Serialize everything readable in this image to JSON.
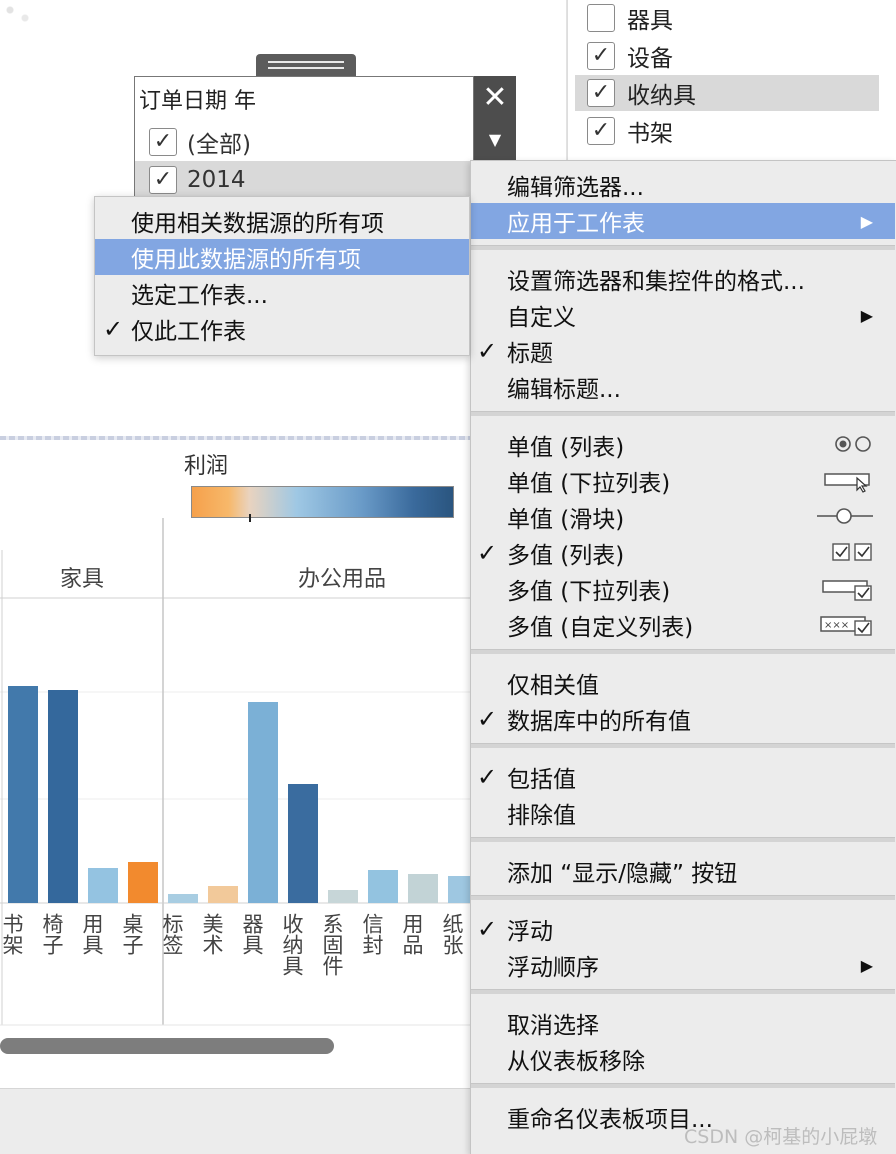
{
  "right_filter": {
    "items": [
      {
        "label": "器具",
        "checked": false,
        "selected": false
      },
      {
        "label": "设备",
        "checked": true,
        "selected": false
      },
      {
        "label": "收纳具",
        "checked": true,
        "selected": true
      },
      {
        "label": "书架",
        "checked": true,
        "selected": false
      }
    ]
  },
  "quick_filter": {
    "title": "订单日期 年",
    "close_icon": "close-icon",
    "dropdown_icon": "dropdown-arrow-icon",
    "items": [
      {
        "label": "(全部)",
        "checked": true,
        "selected": false
      },
      {
        "label": "2014",
        "checked": true,
        "selected": true
      }
    ]
  },
  "legend": {
    "title": "利润",
    "colors": [
      "#f5a04b",
      "#e9d3bf",
      "#9fc8e4",
      "#2a557f"
    ]
  },
  "chart_data": {
    "type": "bar",
    "groups": [
      {
        "name": "家具",
        "categories": [
          "书架",
          "椅子",
          "用具",
          "桌子"
        ]
      },
      {
        "name": "办公用品",
        "categories": [
          "标签",
          "美术",
          "器具",
          "收纳具",
          "系固件",
          "信封",
          "用品",
          "纸张"
        ]
      }
    ],
    "categories": [
      "书架",
      "椅子",
      "用具",
      "桌子",
      "标签",
      "美术",
      "器具",
      "收纳具",
      "系固件",
      "信封",
      "用品",
      "纸张"
    ],
    "values": [
      217,
      213,
      35,
      41,
      9,
      17,
      201,
      119,
      13,
      33,
      29,
      27
    ],
    "colors": [
      "#4279ab",
      "#34689c",
      "#94c3e1",
      "#f28a2e",
      "#a8cde2",
      "#f2c99a",
      "#7bb0d6",
      "#3a6c9f",
      "#c7d6d8",
      "#93c3e0",
      "#c2d3d6",
      "#9ec7e1"
    ],
    "legend_title": "利润",
    "grid": true
  },
  "context_menu": {
    "items": [
      {
        "label": "编辑筛选器...",
        "check": "",
        "arrow": false,
        "icon": ""
      },
      {
        "label": "应用于工作表",
        "check": "",
        "arrow": true,
        "icon": "",
        "highlighted": true
      },
      {
        "sep": true
      },
      {
        "label": "设置筛选器和集控件的格式...",
        "check": "",
        "arrow": false,
        "icon": ""
      },
      {
        "label": "自定义",
        "check": "",
        "arrow": true,
        "icon": ""
      },
      {
        "label": "标题",
        "check": "✓",
        "arrow": false,
        "icon": ""
      },
      {
        "label": "编辑标题...",
        "check": "",
        "arrow": false,
        "icon": ""
      },
      {
        "sep": true
      },
      {
        "label": "单值 (列表)",
        "check": "",
        "arrow": false,
        "icon": "radio-list-icon"
      },
      {
        "label": "单值 (下拉列表)",
        "check": "",
        "arrow": false,
        "icon": "dropdown-cursor-icon"
      },
      {
        "label": "单值 (滑块)",
        "check": "",
        "arrow": false,
        "icon": "slider-icon"
      },
      {
        "label": "多值 (列表)",
        "check": "✓",
        "arrow": false,
        "icon": "checkbox-list-icon"
      },
      {
        "label": "多值 (下拉列表)",
        "check": "",
        "arrow": false,
        "icon": "dropdown-check-icon"
      },
      {
        "label": "多值 (自定义列表)",
        "check": "",
        "arrow": false,
        "icon": "custom-list-icon"
      },
      {
        "sep": true
      },
      {
        "label": "仅相关值",
        "check": "",
        "arrow": false,
        "icon": ""
      },
      {
        "label": "数据库中的所有值",
        "check": "✓",
        "arrow": false,
        "icon": ""
      },
      {
        "sep": true
      },
      {
        "label": "包括值",
        "check": "✓",
        "arrow": false,
        "icon": ""
      },
      {
        "label": "排除值",
        "check": "",
        "arrow": false,
        "icon": ""
      },
      {
        "sep": true
      },
      {
        "label": "添加 “显示/隐藏” 按钮",
        "check": "",
        "arrow": false,
        "icon": ""
      },
      {
        "sep": true
      },
      {
        "label": "浮动",
        "check": "✓",
        "arrow": false,
        "icon": ""
      },
      {
        "label": "浮动顺序",
        "check": "",
        "arrow": true,
        "icon": ""
      },
      {
        "sep": true
      },
      {
        "label": "取消选择",
        "check": "",
        "arrow": false,
        "icon": ""
      },
      {
        "label": "从仪表板移除",
        "check": "",
        "arrow": false,
        "icon": ""
      },
      {
        "sep": true
      },
      {
        "label": "重命名仪表板项目...",
        "check": "",
        "arrow": false,
        "icon": ""
      }
    ]
  },
  "sub_menu": {
    "items": [
      {
        "label": "使用相关数据源的所有项",
        "check": ""
      },
      {
        "label": "使用此数据源的所有项",
        "check": "",
        "highlighted": true
      },
      {
        "label": "选定工作表...",
        "check": ""
      },
      {
        "label": "仅此工作表",
        "check": "✓"
      }
    ]
  },
  "watermark": "CSDN @柯基的小屁墩"
}
